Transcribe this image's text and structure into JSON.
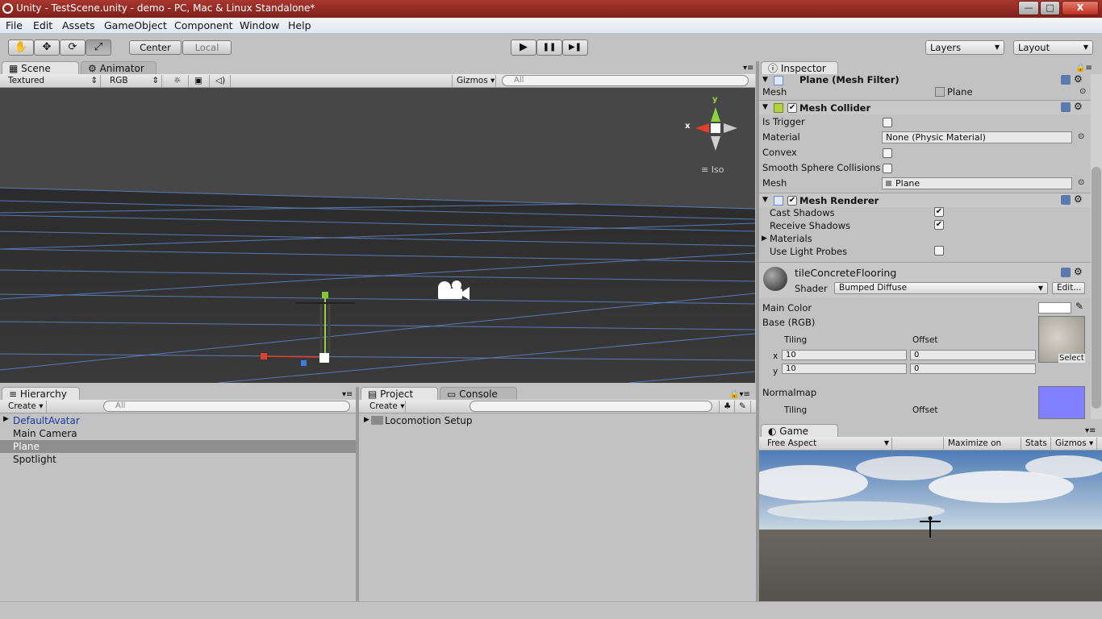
{
  "window": {
    "title": "Unity - TestScene.unity - demo - PC, Mac & Linux Standalone*",
    "min": "—",
    "max": "□",
    "close": "X"
  },
  "menu": [
    "File",
    "Edit",
    "Assets",
    "GameObject",
    "Component",
    "Window",
    "Help"
  ],
  "toolbar": {
    "pivot": "Center",
    "space": "Local",
    "play": "▶",
    "pause": "❚❚",
    "step": "▶❚",
    "layers": "Layers",
    "layout": "Layout"
  },
  "scene": {
    "tab_scene": "Scene",
    "tab_animator": "Animator",
    "render_mode": "Textured",
    "channel": "RGB",
    "gizmos": "Gizmos ▾",
    "search": "All",
    "gizmo_y": "y",
    "gizmo_x": "x",
    "iso": "Iso"
  },
  "hierarchy": {
    "tab": "Hierarchy",
    "create": "Create",
    "search": "All",
    "items": [
      "DefaultAvatar",
      "Main Camera",
      "Plane",
      "Spotlight"
    ]
  },
  "project": {
    "tab": "Project",
    "tab_console": "Console",
    "create": "Create",
    "folder": "Locomotion Setup"
  },
  "inspector": {
    "tab": "Inspector",
    "mesh_filter": {
      "title": "Plane (Mesh Filter)",
      "mesh_label": "Mesh",
      "mesh_value": "Plane"
    },
    "mesh_collider": {
      "title": "Mesh Collider",
      "is_trigger": "Is Trigger",
      "material": "Material",
      "material_value": "None (Physic Material)",
      "convex": "Convex",
      "smooth": "Smooth Sphere Collisions",
      "mesh": "Mesh",
      "mesh_value": "Plane"
    },
    "mesh_renderer": {
      "title": "Mesh Renderer",
      "cast": "Cast Shadows",
      "receive": "Receive Shadows",
      "materials": "Materials",
      "probes": "Use Light Probes"
    },
    "material": {
      "name": "tileConcreteFlooring",
      "shader_label": "Shader",
      "shader": "Bumped Diffuse",
      "edit": "Edit...",
      "main_color": "Main Color",
      "base": "Base (RGB)",
      "tiling": "Tiling",
      "offset": "Offset",
      "x": "x",
      "y": "y",
      "tile_x": "10",
      "tile_y": "10",
      "off_x": "0",
      "off_y": "0",
      "select": "Select",
      "normalmap": "Normalmap",
      "tiling2": "Tiling",
      "offset2": "Offset"
    }
  },
  "game": {
    "tab": "Game",
    "aspect": "Free Aspect",
    "maximize": "Maximize on Play",
    "stats": "Stats",
    "gizmos": "Gizmos ▾"
  }
}
